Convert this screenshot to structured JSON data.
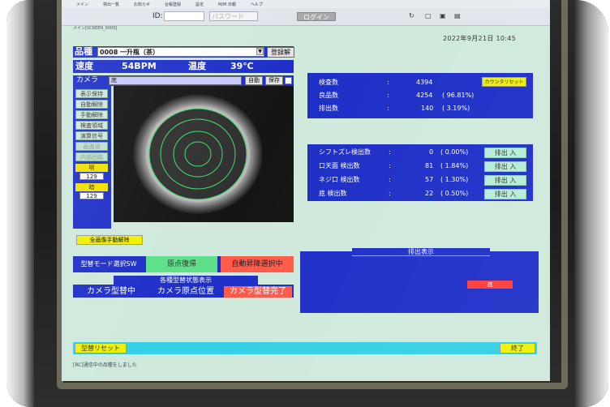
{
  "menu": {
    "items": [
      "メイン",
      "検出一覧",
      "お知らせ",
      "台帳登録",
      "設定",
      "M/M 日報",
      "ヘルプ"
    ]
  },
  "topbar": {
    "id_label": "ID:",
    "password_placeholder": "パスワード",
    "login_label": "ログイン"
  },
  "screen_id": "メイン[SCREEN_0000]",
  "datetime": "2022年9月21日  10:45",
  "product": {
    "label": "品種",
    "selected": "0008 一升瓶（茶）",
    "register_label": "登録解"
  },
  "speed": {
    "speed_label": "速度",
    "speed_value": "54BPM",
    "temp_label": "温度",
    "temp_value": "39℃"
  },
  "camera": {
    "label": "カメラ",
    "selected": "底",
    "auto_label": "自動",
    "save_label": "保存"
  },
  "side_buttons": [
    {
      "label": "表示保持",
      "state": "on"
    },
    {
      "label": "自動解除",
      "state": "on"
    },
    {
      "label": "手動解除",
      "state": "on"
    },
    {
      "label": "検査領域",
      "state": "on"
    },
    {
      "label": "演算信号",
      "state": "on"
    },
    {
      "label": "画面消",
      "state": "dim"
    },
    {
      "label": "内部回路",
      "state": "dim"
    }
  ],
  "adjust": {
    "light_label": "明",
    "light_value": "129",
    "dark_label": "暗",
    "dark_value": "129"
  },
  "manual_release_label": "全画像手動解除",
  "mode": {
    "mold_mode_label": "型替モード選択SW",
    "origin_return_label": "原点復帰",
    "auto_select_label": "自動昇降選択中"
  },
  "state_display": {
    "title": "各種型替状態表示",
    "items": [
      {
        "label": "カメラ型替中",
        "highlight": false
      },
      {
        "label": "カメラ原点位置",
        "highlight": false
      },
      {
        "label": "カメラ型替完了",
        "highlight": true
      }
    ]
  },
  "counts": {
    "inspected_label": "検査数",
    "inspected_value": "4394",
    "good_label": "良品数",
    "good_value": "4254",
    "good_pct": "( 96.81%)",
    "rejected_label": "排出数",
    "rejected_value": "140",
    "rejected_pct": "(  3.19%)",
    "reset_label": "カウンタリセット"
  },
  "defects": [
    {
      "label": "シフトズレ検出数",
      "value": "0",
      "pct": "(  0.00%)",
      "btn": "排出 入"
    },
    {
      "label": "口天面  検出数",
      "value": "81",
      "pct": "(  1.84%)",
      "btn": "排出 入"
    },
    {
      "label": "ネジ口  検出数",
      "value": "57",
      "pct": "(  1.30%)",
      "btn": "排出 入"
    },
    {
      "label": "底   検出数",
      "value": "22",
      "pct": "(  0.50%)",
      "btn": "排出 入"
    }
  ],
  "eject_display": {
    "title": "排出表示",
    "bottom_label": "底"
  },
  "footer": {
    "mold_reset_label": "型替リセット",
    "end_label": "終了",
    "status": "[RC]通信中の品種をしました"
  },
  "colors": {
    "panel_blue": "#1e2fc8",
    "screen_bg": "#cfe9dc",
    "yellow": "#f0f000",
    "green": "#5ee08a",
    "red": "#ff5a4a",
    "cyan": "#35d0e6"
  }
}
